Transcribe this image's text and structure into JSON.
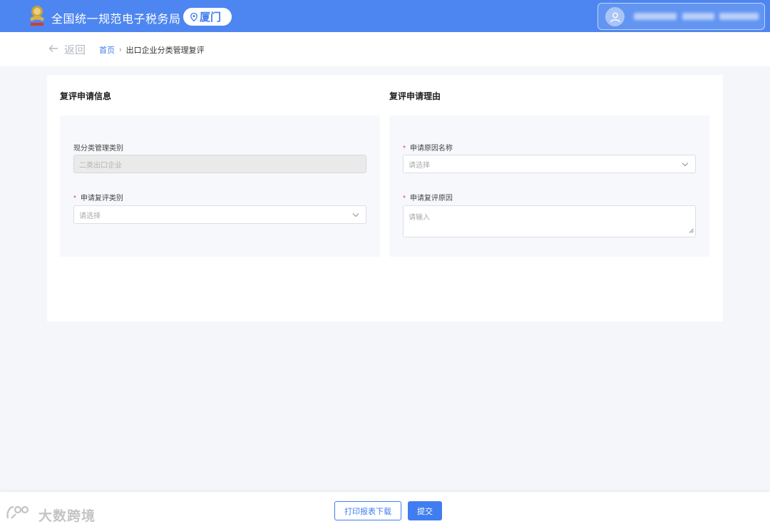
{
  "header": {
    "site_title": "全国统一规范电子税务局",
    "city": "厦门",
    "brand_color": "#4d86f0"
  },
  "nav": {
    "back_label": "返回",
    "breadcrumb_home": "首页",
    "breadcrumb_separator": "›",
    "breadcrumb_current": "出口企业分类管理复评"
  },
  "left_section": {
    "title": "复评申请信息",
    "current_category_label": "现分类管理类别",
    "current_category_value": "二类出口企业",
    "apply_category_label": "申请复评类别",
    "apply_category_placeholder": "请选择"
  },
  "right_section": {
    "title": "复评申请理由",
    "reason_name_label": "申请原因名称",
    "reason_name_placeholder": "请选择",
    "reason_label": "申请复评原因",
    "reason_placeholder": "请输入"
  },
  "required_mark": "*",
  "footer": {
    "print_label": "打印报表下载",
    "submit_label": "提交"
  },
  "watermark": {
    "text": "大数跨境"
  },
  "icons": {
    "logo": "tax-emblem-icon",
    "pin": "location-pin-icon",
    "user": "user-avatar-icon",
    "back": "arrow-left-icon",
    "chevron": "chevron-down-icon"
  }
}
